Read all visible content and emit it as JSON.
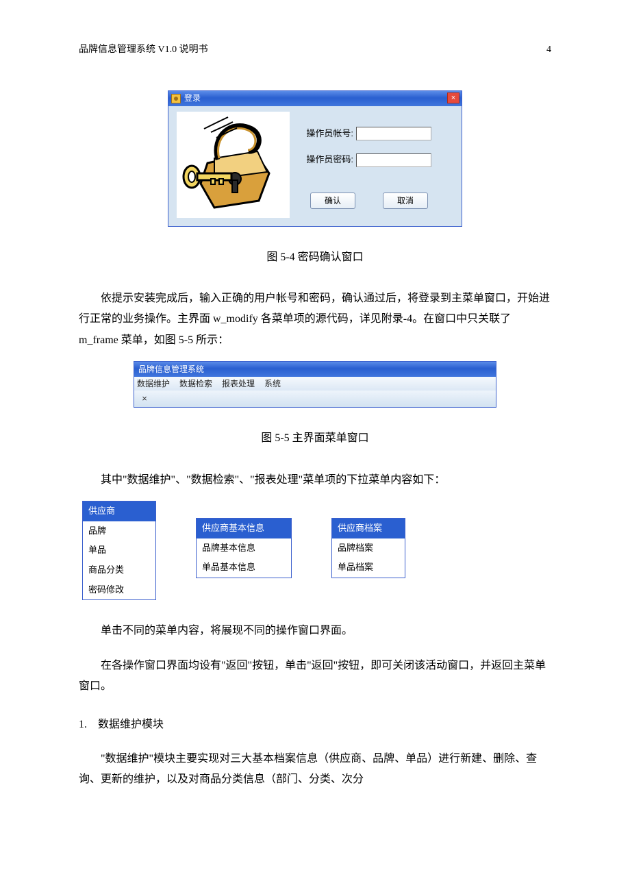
{
  "header": {
    "title": "品牌信息管理系统 V1.0 说明书",
    "page": "4"
  },
  "login": {
    "titlebar": "登录",
    "close_glyph": "×",
    "label_account": "操作员帐号:",
    "label_password": "操作员密码:",
    "btn_ok": "确认",
    "btn_cancel": "取消",
    "val_account": "",
    "val_password": ""
  },
  "caption1": "图 5-4  密码确认窗口",
  "para1": "依提示安装完成后，输入正确的用户帐号和密码，确认通过后，将登录到主菜单窗口，开始进行正常的业务操作。主界面 w_modify 各菜单项的源代码，详见附录-4。在窗口中只关联了 m_frame 菜单，如图 5-5 所示：",
  "menubar": {
    "title": "品牌信息管理系统",
    "items": [
      "数据维护",
      "数据检索",
      "报表处理",
      "系统"
    ],
    "tool_x": "×"
  },
  "caption2": "图 5-5    主界面菜单窗口",
  "para2": "其中\"数据维护\"、\"数据检索\"、\"报表处理\"菜单项的下拉菜单内容如下：",
  "menus": {
    "menu1": {
      "highlight": "供应商",
      "items": [
        "品牌",
        "单品",
        "商品分类",
        "密码修改"
      ]
    },
    "menu2": {
      "highlight": "供应商基本信息",
      "items": [
        "品牌基本信息",
        "单品基本信息"
      ]
    },
    "menu3": {
      "highlight": "供应商档案",
      "items": [
        "品牌档案",
        "单品档案"
      ]
    }
  },
  "para3": "单击不同的菜单内容，将展现不同的操作窗口界面。",
  "para4": "在各操作窗口界面均设有\"返回\"按钮，单击\"返回\"按钮，即可关闭该活动窗口，并返回主菜单窗口。",
  "section1": {
    "num": "1.",
    "title": "数据维护模块"
  },
  "para5": "\"数据维护\"模块主要实现对三大基本档案信息（供应商、品牌、单品）进行新建、删除、查询、更新的维护，以及对商品分类信息（部门、分类、次分"
}
